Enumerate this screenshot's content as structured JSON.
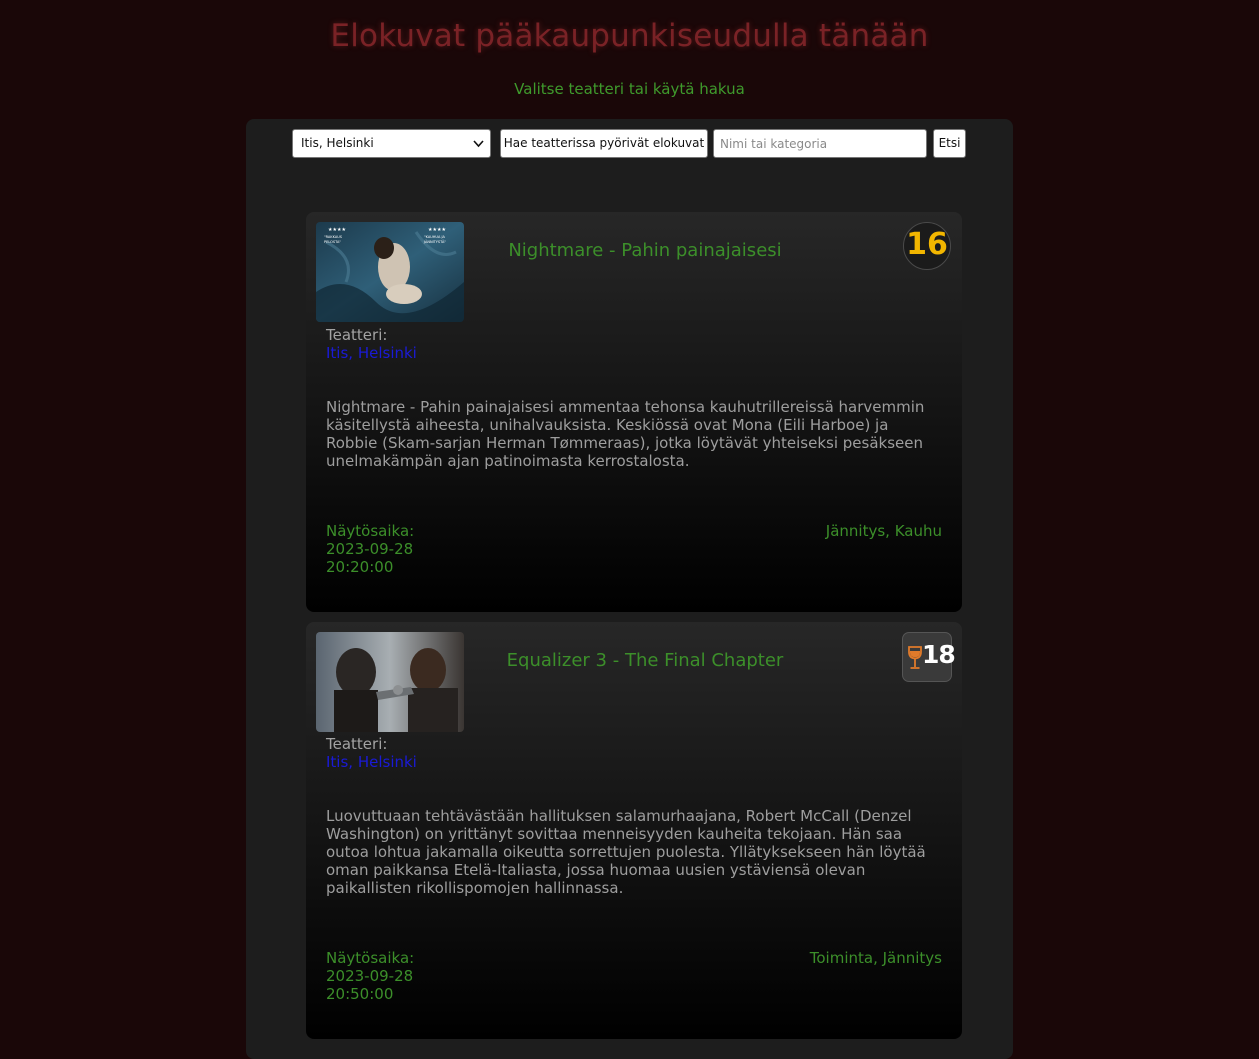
{
  "header": {
    "title": "Elokuvat pääkaupunkiseudulla tänään",
    "subtitle": "Valitse teatteri tai käytä hakua"
  },
  "controls": {
    "theatre_selected": "Itis, Helsinki",
    "fetch_button": "Hae teatterissa pyörivät elokuvat",
    "search_placeholder": "Nimi tai kategoria",
    "search_value": "",
    "search_button": "Etsi"
  },
  "movies": [
    {
      "title": "Nightmare - Pahin painajaisesi",
      "rating": "16",
      "theatre_label": "Teatteri:",
      "theatre": "Itis, Helsinki",
      "description": "Nightmare - Pahin painajaisesi ammentaa tehonsa kauhutrillereissä harvemmin käsitellystä aiheesta, unihalvauksista. Keskiössä ovat Mona (Eili Harboe) ja Robbie (Skam-sarjan Herman Tømmeraas), jotka löytävät yhteiseksi pesäkseen unelmakämpän ajan patinoimasta kerrostalosta.",
      "showtime_label": "Näytösaika:",
      "date": "2023-09-28",
      "time": "20:20:00",
      "genres": "Jännitys, Kauhu"
    },
    {
      "title": "Equalizer 3 - The Final Chapter",
      "rating": "18",
      "theatre_label": "Teatteri:",
      "theatre": "Itis, Helsinki",
      "description": "Luovuttuaan tehtävästään hallituksen salamurhaajana, Robert McCall (Denzel Washington) on yrittänyt sovittaa menneisyyden kauheita tekojaan. Hän saa outoa lohtua jakamalla oikeutta sorrettujen puolesta. Yllätyksekseen hän löytää oman paikkansa Etelä-Italiasta, jossa huomaa uusien ystäviensä olevan paikallisten rikollispomojen hallinnassa.",
      "showtime_label": "Näytösaika:",
      "date": "2023-09-28",
      "time": "20:50:00",
      "genres": "Toiminta, Jännitys"
    }
  ],
  "colors": {
    "background": "#1a0708",
    "title": "#7a2226",
    "accent_green": "#3c8f2a",
    "link_blue": "#1a1ad6",
    "rating16": "#f2b600"
  }
}
